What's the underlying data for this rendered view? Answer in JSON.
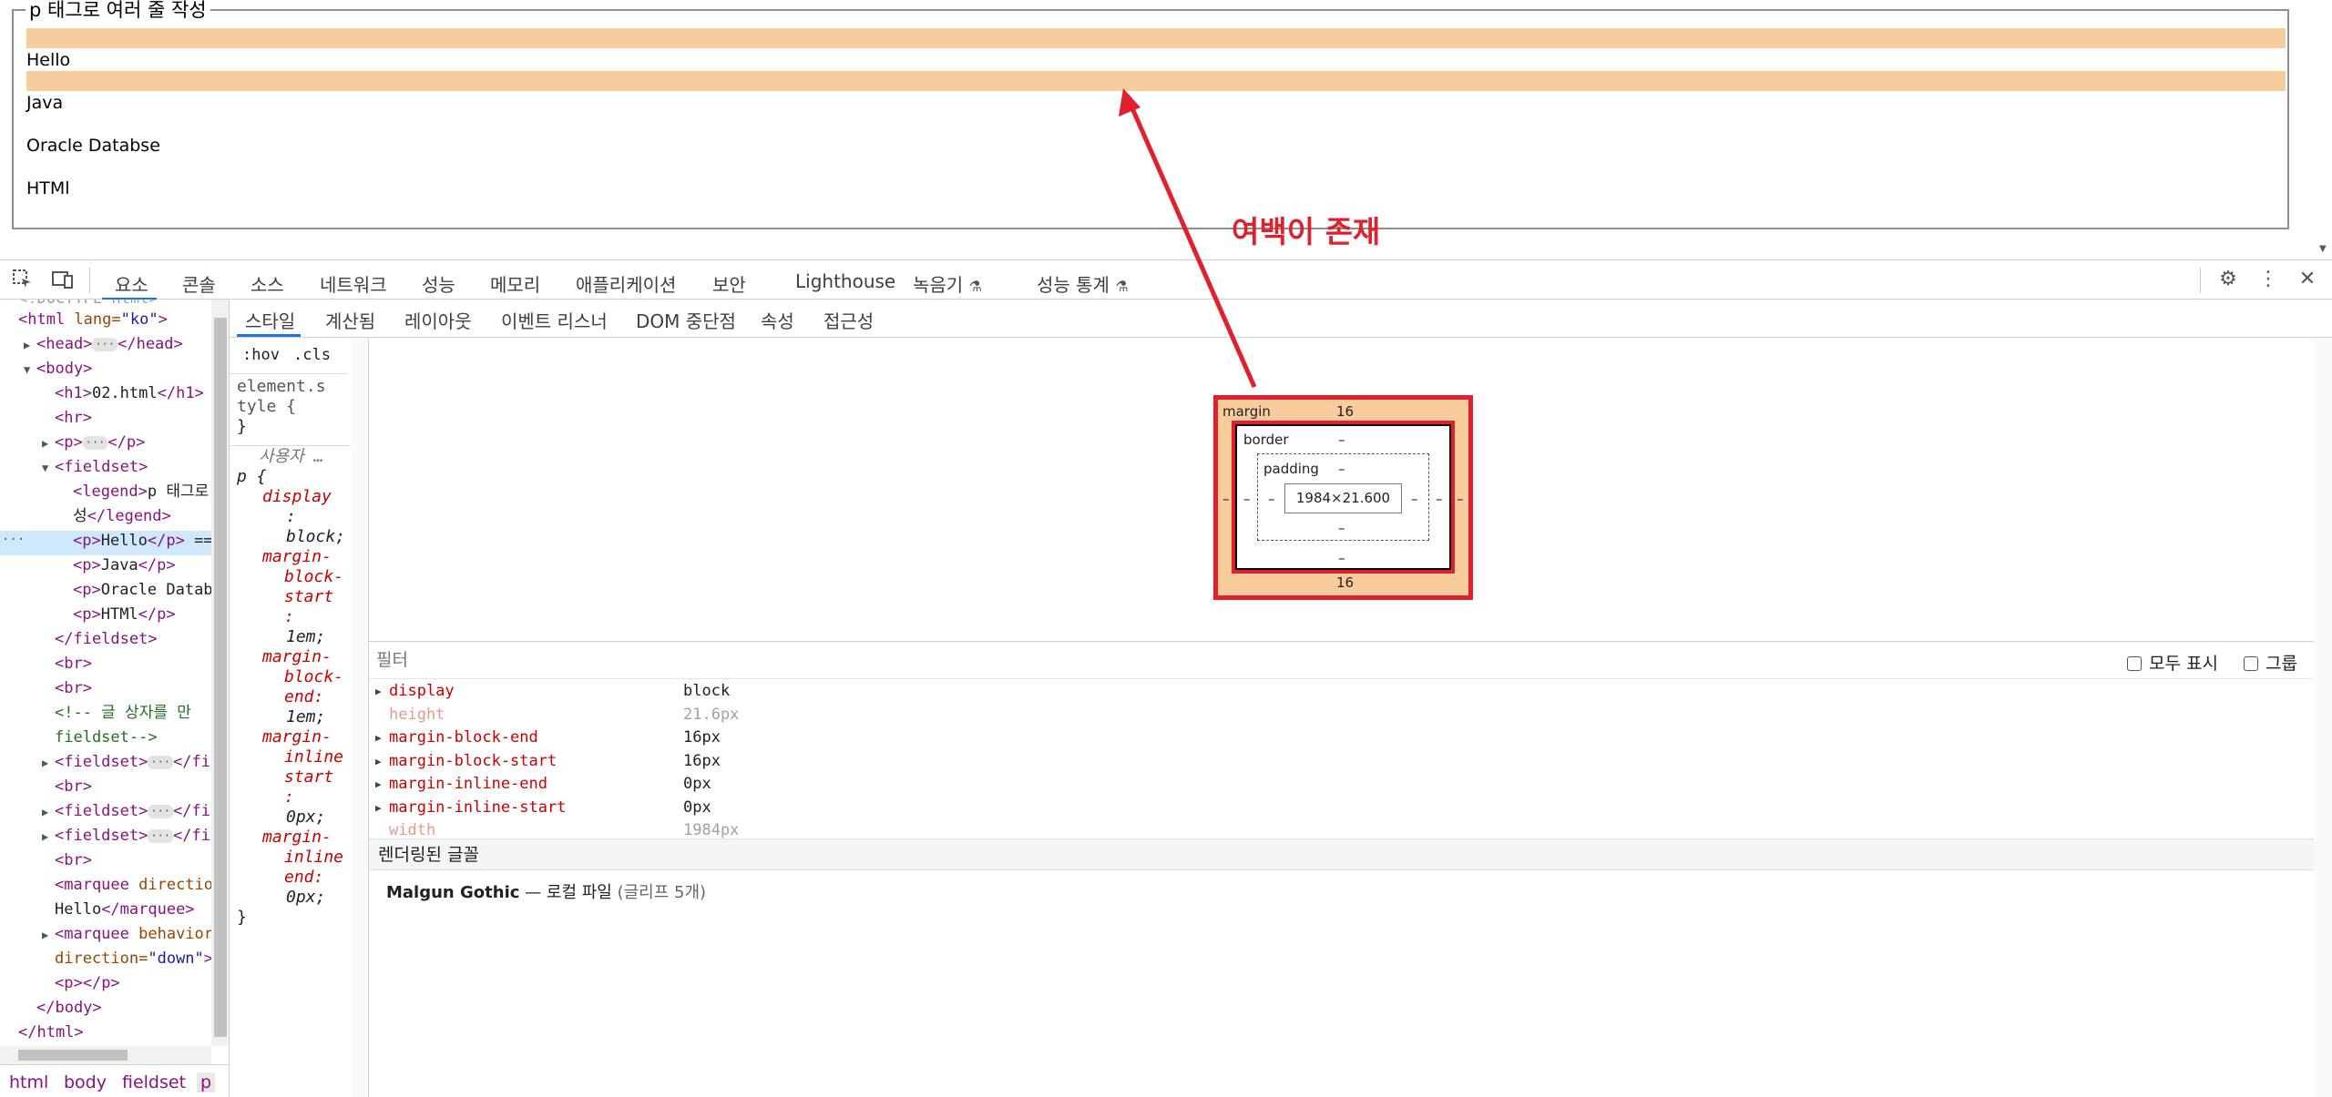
{
  "page": {
    "legend": "p 태그로 여러 줄 작성",
    "paragraphs": [
      "Hello",
      "Java",
      "Oracle Databse",
      "HTMl"
    ],
    "annotation": "여백이 존재"
  },
  "toolbar": {
    "tabs": [
      "요소",
      "콘솔",
      "소스",
      "네트워크",
      "성능",
      "메모리",
      "애플리케이션",
      "보안",
      "Lighthouse",
      "녹음기",
      "성능 통계"
    ]
  },
  "elements": {
    "doctype": "<!DOCTYPE html>",
    "lines": [
      {
        "indent": 0,
        "tri": "",
        "open": "<html ",
        "attr": "lang",
        "val": "\"ko\"",
        "close": ">"
      },
      {
        "indent": 1,
        "tri": "▶",
        "open": "<head>",
        "dots": true,
        "end": "</head>"
      },
      {
        "indent": 1,
        "tri": "▼",
        "open": "<body>"
      },
      {
        "indent": 2,
        "tri": "",
        "open": "<h1>",
        "text": "02.html",
        "end": "</h1>"
      },
      {
        "indent": 2,
        "tri": "",
        "open": "<hr>"
      },
      {
        "indent": 2,
        "tri": "▶",
        "open": "<p>",
        "dots": true,
        "end": "</p>"
      },
      {
        "indent": 2,
        "tri": "▼",
        "open": "<fieldset>"
      },
      {
        "indent": 3,
        "tri": "",
        "open": "<legend>",
        "text": "p 태그로"
      },
      {
        "indent": 3,
        "tri": "",
        "text": "성",
        "end": "</legend>"
      },
      {
        "indent": 3,
        "tri": "",
        "open": "<p>",
        "text": "Hello",
        "end": "</p>",
        "suffix": " =="
      },
      {
        "indent": 3,
        "tri": "",
        "open": "<p>",
        "text": "Java",
        "end": "</p>"
      },
      {
        "indent": 3,
        "tri": "",
        "open": "<p>",
        "text": "Oracle Datab"
      },
      {
        "indent": 3,
        "tri": "",
        "open": "<p>",
        "text": "HTMl",
        "end": "</p>"
      },
      {
        "indent": 2,
        "tri": "",
        "end": "</fieldset>"
      },
      {
        "indent": 2,
        "tri": "",
        "open": "<br>"
      },
      {
        "indent": 2,
        "tri": "",
        "open": "<br>"
      },
      {
        "indent": 2,
        "tri": "",
        "comment": "<!-- 글 상자를 만"
      },
      {
        "indent": 2,
        "tri": "",
        "comment": "fieldset-->"
      },
      {
        "indent": 2,
        "tri": "▶",
        "open": "<fieldset>",
        "dots": true,
        "end": "</fi"
      },
      {
        "indent": 2,
        "tri": "",
        "open": "<br>"
      },
      {
        "indent": 2,
        "tri": "▶",
        "open": "<fieldset>",
        "dots": true,
        "end": "</fi"
      },
      {
        "indent": 2,
        "tri": "▶",
        "open": "<fieldset>",
        "dots": true,
        "end": "</fi"
      },
      {
        "indent": 2,
        "tri": "",
        "open": "<br>"
      },
      {
        "indent": 2,
        "tri": "",
        "open": "<marquee ",
        "attr": "directio"
      },
      {
        "indent": 2,
        "tri": "",
        "text": "Hello",
        "end": "</marquee>"
      },
      {
        "indent": 2,
        "tri": "▶",
        "open": "<marquee ",
        "attr": "behavior"
      },
      {
        "indent": 2,
        "tri": "",
        "attr": "direction",
        "val": "\"down\"",
        "close": ">"
      },
      {
        "indent": 2,
        "tri": "",
        "open": "<p>",
        "end": "</p>"
      },
      {
        "indent": 1,
        "tri": "",
        "end": "</body>"
      },
      {
        "indent": 0,
        "tri": "",
        "end": "</html>"
      }
    ],
    "selected_dots": "···",
    "breadcrumbs": [
      "html",
      "body",
      "fieldset",
      "p"
    ]
  },
  "subtabs": [
    "스타일",
    "계산됨",
    "레이아웃",
    "이벤트 리스너",
    "DOM 중단점",
    "속성",
    "접근성"
  ],
  "styles": {
    "hov": ":hov",
    "cls": ".cls",
    "element_style_1": "element.s",
    "element_style_2": "tyle {",
    "brace_close": "}",
    "user_agent": "사용자 …",
    "selector": "p {",
    "rules": [
      {
        "prop": "display",
        "lines": [
          ":",
          "block;"
        ]
      },
      {
        "prop": "margin-",
        "lines2": [
          "block-",
          "start",
          ":",
          "1em;"
        ]
      },
      {
        "prop": "margin-",
        "lines2": [
          "block-",
          "end:",
          "1em;"
        ]
      },
      {
        "prop": "margin-",
        "lines2": [
          "inline",
          "start",
          ":",
          "0px;"
        ]
      },
      {
        "prop": "margin-",
        "lines2": [
          "inline",
          "end:",
          "0px;"
        ]
      }
    ]
  },
  "boxmodel": {
    "margin_label": "margin",
    "margin_top": "16",
    "margin_bottom": "16",
    "margin_left": "–",
    "margin_right": "–",
    "border_label": "border",
    "border_top": "–",
    "border_bottom": "–",
    "border_left": "–",
    "border_right": "–",
    "padding_label": "padding",
    "padding_top": "–",
    "padding_bottom": "–",
    "padding_left": "–",
    "padding_right": "–",
    "content": "1984×21.600"
  },
  "computed": {
    "filter_placeholder": "필터",
    "show_all": "모두 표시",
    "group": "그룹",
    "rows": [
      {
        "name": "display",
        "value": "block",
        "expandable": true,
        "dim": false
      },
      {
        "name": "height",
        "value": "21.6px",
        "expandable": false,
        "dim": true
      },
      {
        "name": "margin-block-end",
        "value": "16px",
        "expandable": true,
        "dim": false
      },
      {
        "name": "margin-block-start",
        "value": "16px",
        "expandable": true,
        "dim": false
      },
      {
        "name": "margin-inline-end",
        "value": "0px",
        "expandable": true,
        "dim": false
      },
      {
        "name": "margin-inline-start",
        "value": "0px",
        "expandable": true,
        "dim": false
      },
      {
        "name": "width",
        "value": "1984px",
        "expandable": false,
        "dim": true
      }
    ],
    "fonts_heading": "렌더링된 글꼴",
    "font_name": "Malgun Gothic",
    "font_dash": "—",
    "font_source": "로컬 파일",
    "font_glyphs": "(글리프 5개)"
  },
  "colors": {
    "highlight": "#f9cc9d",
    "annotation": "#e0202b",
    "tag": "#881280",
    "prop": "#c80000"
  }
}
